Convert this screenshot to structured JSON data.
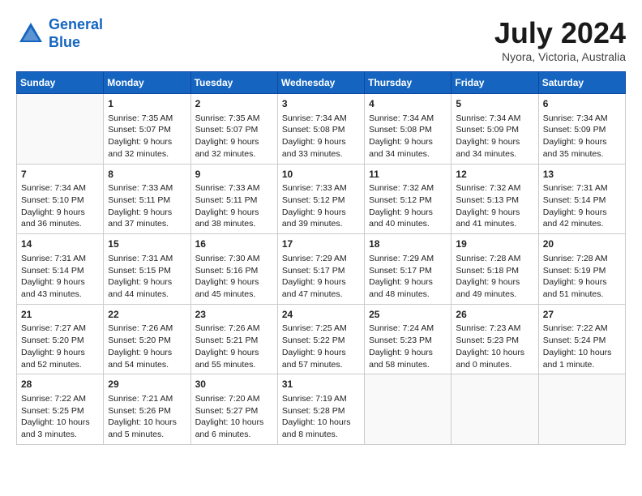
{
  "header": {
    "logo_line1": "General",
    "logo_line2": "Blue",
    "title": "July 2024",
    "location": "Nyora, Victoria, Australia"
  },
  "days_of_week": [
    "Sunday",
    "Monday",
    "Tuesday",
    "Wednesday",
    "Thursday",
    "Friday",
    "Saturday"
  ],
  "weeks": [
    [
      {
        "day": "",
        "info": ""
      },
      {
        "day": "1",
        "info": "Sunrise: 7:35 AM\nSunset: 5:07 PM\nDaylight: 9 hours\nand 32 minutes."
      },
      {
        "day": "2",
        "info": "Sunrise: 7:35 AM\nSunset: 5:07 PM\nDaylight: 9 hours\nand 32 minutes."
      },
      {
        "day": "3",
        "info": "Sunrise: 7:34 AM\nSunset: 5:08 PM\nDaylight: 9 hours\nand 33 minutes."
      },
      {
        "day": "4",
        "info": "Sunrise: 7:34 AM\nSunset: 5:08 PM\nDaylight: 9 hours\nand 34 minutes."
      },
      {
        "day": "5",
        "info": "Sunrise: 7:34 AM\nSunset: 5:09 PM\nDaylight: 9 hours\nand 34 minutes."
      },
      {
        "day": "6",
        "info": "Sunrise: 7:34 AM\nSunset: 5:09 PM\nDaylight: 9 hours\nand 35 minutes."
      }
    ],
    [
      {
        "day": "7",
        "info": "Sunrise: 7:34 AM\nSunset: 5:10 PM\nDaylight: 9 hours\nand 36 minutes."
      },
      {
        "day": "8",
        "info": "Sunrise: 7:33 AM\nSunset: 5:11 PM\nDaylight: 9 hours\nand 37 minutes."
      },
      {
        "day": "9",
        "info": "Sunrise: 7:33 AM\nSunset: 5:11 PM\nDaylight: 9 hours\nand 38 minutes."
      },
      {
        "day": "10",
        "info": "Sunrise: 7:33 AM\nSunset: 5:12 PM\nDaylight: 9 hours\nand 39 minutes."
      },
      {
        "day": "11",
        "info": "Sunrise: 7:32 AM\nSunset: 5:12 PM\nDaylight: 9 hours\nand 40 minutes."
      },
      {
        "day": "12",
        "info": "Sunrise: 7:32 AM\nSunset: 5:13 PM\nDaylight: 9 hours\nand 41 minutes."
      },
      {
        "day": "13",
        "info": "Sunrise: 7:31 AM\nSunset: 5:14 PM\nDaylight: 9 hours\nand 42 minutes."
      }
    ],
    [
      {
        "day": "14",
        "info": "Sunrise: 7:31 AM\nSunset: 5:14 PM\nDaylight: 9 hours\nand 43 minutes."
      },
      {
        "day": "15",
        "info": "Sunrise: 7:31 AM\nSunset: 5:15 PM\nDaylight: 9 hours\nand 44 minutes."
      },
      {
        "day": "16",
        "info": "Sunrise: 7:30 AM\nSunset: 5:16 PM\nDaylight: 9 hours\nand 45 minutes."
      },
      {
        "day": "17",
        "info": "Sunrise: 7:29 AM\nSunset: 5:17 PM\nDaylight: 9 hours\nand 47 minutes."
      },
      {
        "day": "18",
        "info": "Sunrise: 7:29 AM\nSunset: 5:17 PM\nDaylight: 9 hours\nand 48 minutes."
      },
      {
        "day": "19",
        "info": "Sunrise: 7:28 AM\nSunset: 5:18 PM\nDaylight: 9 hours\nand 49 minutes."
      },
      {
        "day": "20",
        "info": "Sunrise: 7:28 AM\nSunset: 5:19 PM\nDaylight: 9 hours\nand 51 minutes."
      }
    ],
    [
      {
        "day": "21",
        "info": "Sunrise: 7:27 AM\nSunset: 5:20 PM\nDaylight: 9 hours\nand 52 minutes."
      },
      {
        "day": "22",
        "info": "Sunrise: 7:26 AM\nSunset: 5:20 PM\nDaylight: 9 hours\nand 54 minutes."
      },
      {
        "day": "23",
        "info": "Sunrise: 7:26 AM\nSunset: 5:21 PM\nDaylight: 9 hours\nand 55 minutes."
      },
      {
        "day": "24",
        "info": "Sunrise: 7:25 AM\nSunset: 5:22 PM\nDaylight: 9 hours\nand 57 minutes."
      },
      {
        "day": "25",
        "info": "Sunrise: 7:24 AM\nSunset: 5:23 PM\nDaylight: 9 hours\nand 58 minutes."
      },
      {
        "day": "26",
        "info": "Sunrise: 7:23 AM\nSunset: 5:23 PM\nDaylight: 10 hours\nand 0 minutes."
      },
      {
        "day": "27",
        "info": "Sunrise: 7:22 AM\nSunset: 5:24 PM\nDaylight: 10 hours\nand 1 minute."
      }
    ],
    [
      {
        "day": "28",
        "info": "Sunrise: 7:22 AM\nSunset: 5:25 PM\nDaylight: 10 hours\nand 3 minutes."
      },
      {
        "day": "29",
        "info": "Sunrise: 7:21 AM\nSunset: 5:26 PM\nDaylight: 10 hours\nand 5 minutes."
      },
      {
        "day": "30",
        "info": "Sunrise: 7:20 AM\nSunset: 5:27 PM\nDaylight: 10 hours\nand 6 minutes."
      },
      {
        "day": "31",
        "info": "Sunrise: 7:19 AM\nSunset: 5:28 PM\nDaylight: 10 hours\nand 8 minutes."
      },
      {
        "day": "",
        "info": ""
      },
      {
        "day": "",
        "info": ""
      },
      {
        "day": "",
        "info": ""
      }
    ]
  ]
}
